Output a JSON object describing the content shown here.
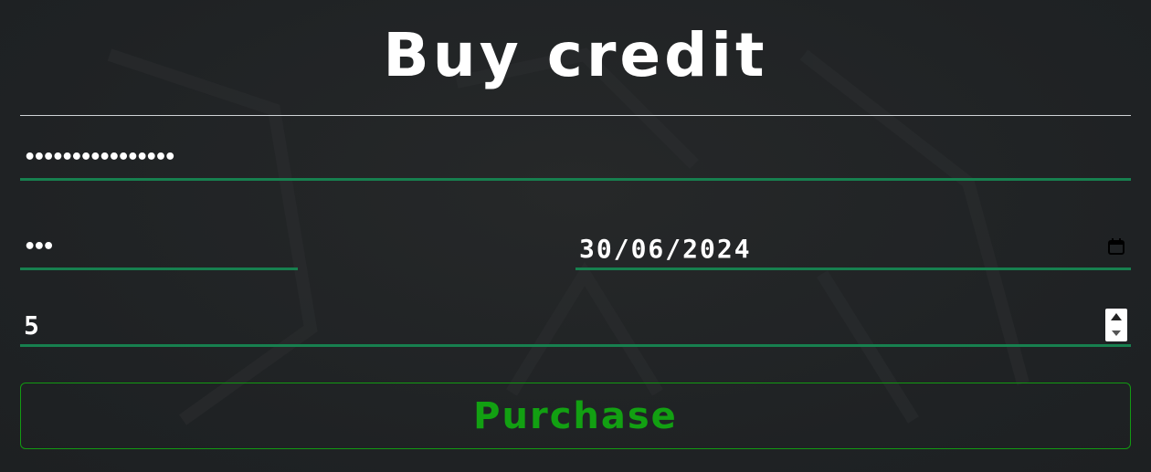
{
  "page": {
    "title": "Buy credit"
  },
  "form": {
    "card_number": {
      "value": "••••••••••••••••"
    },
    "cvv": {
      "value": "•••"
    },
    "expiry_date": {
      "value": "30/06/2024",
      "icon": "calendar-icon"
    },
    "quantity": {
      "value": "5"
    },
    "purchase_button": {
      "label": "Purchase"
    }
  },
  "colors": {
    "background": "#202325",
    "accent_underline": "#17804f",
    "button_green": "#12a012",
    "divider": "#cfd3d6",
    "text": "#ffffff"
  }
}
